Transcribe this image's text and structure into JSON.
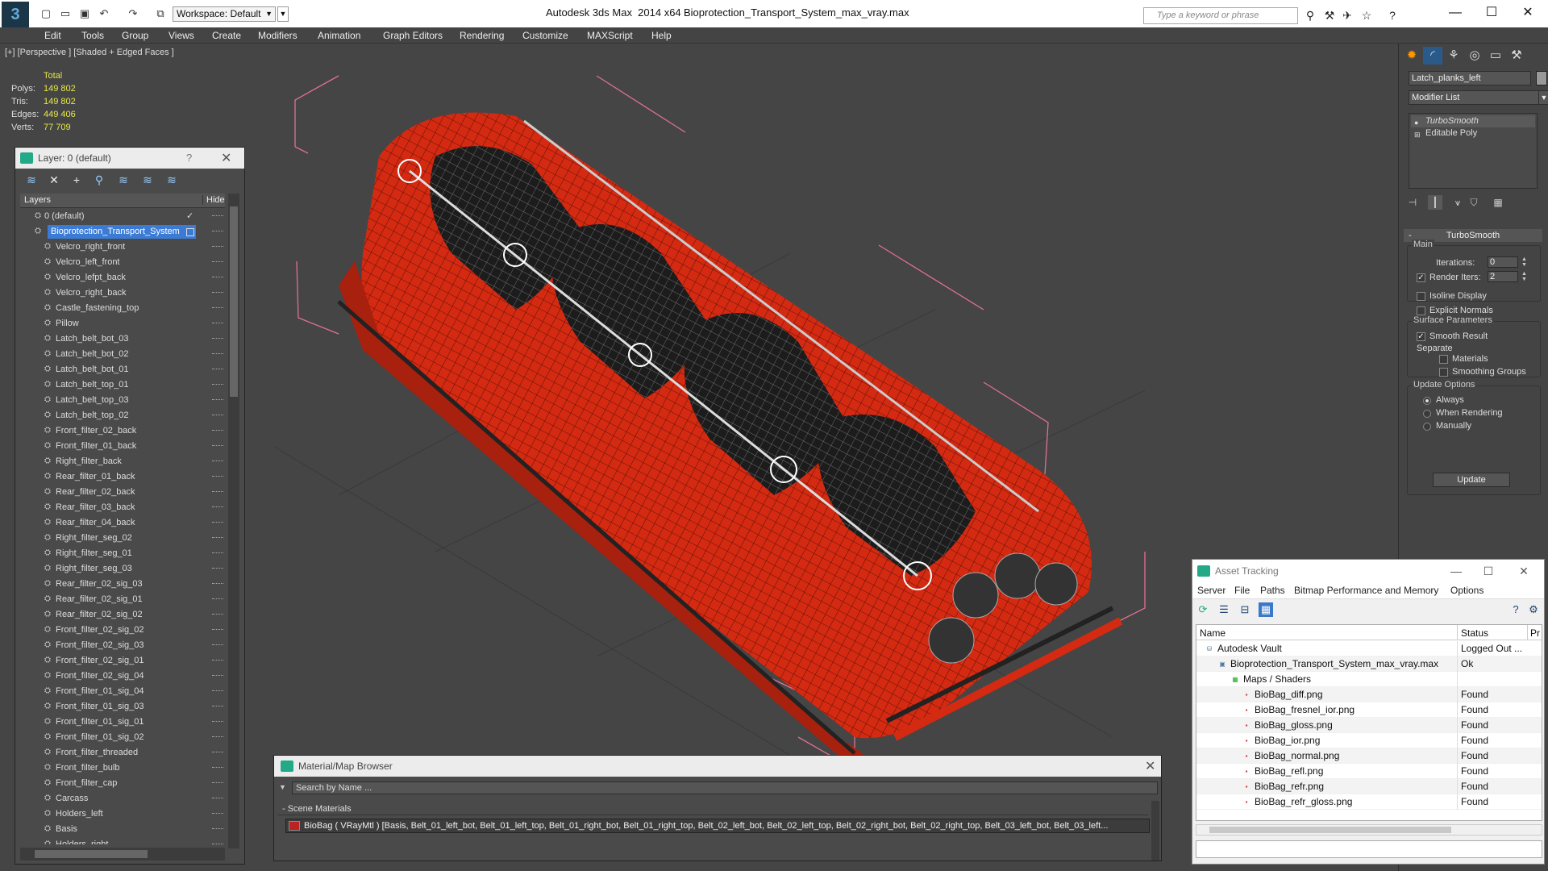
{
  "titlebar": {
    "workspace": "Workspace: Default",
    "app_title": "Autodesk 3ds Max  2014 x64",
    "document": "Bioprotection_Transport_System_max_vray.max",
    "search_placeholder": "Type a keyword or phrase"
  },
  "menu": [
    "Edit",
    "Tools",
    "Group",
    "Views",
    "Create",
    "Modifiers",
    "Animation",
    "Graph Editors",
    "Rendering",
    "Customize",
    "MAXScript",
    "Help"
  ],
  "viewport": {
    "label": "[+] [Perspective ] [Shaded + Edged Faces ]",
    "stats": {
      "header": "Total",
      "rows": [
        {
          "label": "Polys:",
          "value": "149 802"
        },
        {
          "label": "Tris:",
          "value": "149 802"
        },
        {
          "label": "Edges:",
          "value": "449 406"
        },
        {
          "label": "Verts:",
          "value": "77 709"
        }
      ]
    }
  },
  "layer_panel": {
    "title": "Layer: 0 (default)",
    "help": "?",
    "col_layers": "Layers",
    "col_hide": "Hide",
    "default_layer": "0 (default)",
    "selected_layer": "Bioprotection_Transport_System",
    "objects": [
      "Velcro_right_front",
      "Velcro_left_front",
      "Velcro_lefpt_back",
      "Velcro_right_back",
      "Castle_fastening_top",
      "Pillow",
      "Latch_belt_bot_03",
      "Latch_belt_bot_02",
      "Latch_belt_bot_01",
      "Latch_belt_top_01",
      "Latch_belt_top_03",
      "Latch_belt_top_02",
      "Front_filter_02_back",
      "Front_filter_01_back",
      "Right_filter_back",
      "Rear_filter_01_back",
      "Rear_filter_02_back",
      "Rear_filter_03_back",
      "Rear_filter_04_back",
      "Right_filter_seg_02",
      "Right_filter_seg_01",
      "Right_filter_seg_03",
      "Rear_filter_02_sig_03",
      "Rear_filter_02_sig_01",
      "Rear_filter_02_sig_02",
      "Front_filter_02_sig_02",
      "Front_filter_02_sig_03",
      "Front_filter_02_sig_01",
      "Front_filter_02_sig_04",
      "Front_filter_01_sig_04",
      "Front_filter_01_sig_03",
      "Front_filter_01_sig_01",
      "Front_filter_01_sig_02",
      "Front_filter_threaded",
      "Front_filter_bulb",
      "Front_filter_cap",
      "Carcass",
      "Holders_left",
      "Basis",
      "Holders_right"
    ]
  },
  "command_panel": {
    "object_name": "Latch_planks_left",
    "modifier_list": "Modifier List",
    "stack": [
      "TurboSmooth",
      "Editable Poly"
    ],
    "rollout": "TurboSmooth",
    "main_group": "Main",
    "iterations_label": "Iterations:",
    "iterations": "0",
    "render_iters_label": "Render Iters:",
    "render_iters": "2",
    "isoline": "Isoline Display",
    "explicit_normals": "Explicit Normals",
    "surface_group": "Surface Parameters",
    "smooth_result": "Smooth Result",
    "separate": "Separate",
    "materials": "Materials",
    "smoothing_groups": "Smoothing Groups",
    "update_group": "Update Options",
    "always": "Always",
    "when_rendering": "When Rendering",
    "manually": "Manually",
    "update_btn": "Update"
  },
  "material_browser": {
    "title": "Material/Map Browser",
    "search_placeholder": "Search by Name ...",
    "section": "- Scene Materials",
    "material": "BioBag ( VRayMtl ) [Basis, Belt_01_left_bot, Belt_01_left_top, Belt_01_right_bot, Belt_01_right_top, Belt_02_left_bot, Belt_02_left_top, Belt_02_right_bot, Belt_02_right_top, Belt_03_left_bot, Belt_03_left..."
  },
  "asset_tracking": {
    "title": "Asset Tracking",
    "menu": [
      "Server",
      "File",
      "Paths",
      "Bitmap Performance and Memory",
      "Options"
    ],
    "col_name": "Name",
    "col_status": "Status",
    "col_pr": "Pr",
    "rows": [
      {
        "name": "Autodesk Vault",
        "status": "Logged Out ..."
      },
      {
        "name": "Bioprotection_Transport_System_max_vray.max",
        "status": "Ok"
      },
      {
        "name": "Maps / Shaders",
        "status": ""
      },
      {
        "name": "BioBag_diff.png",
        "status": "Found"
      },
      {
        "name": "BioBag_fresnel_ior.png",
        "status": "Found"
      },
      {
        "name": "BioBag_gloss.png",
        "status": "Found"
      },
      {
        "name": "BioBag_ior.png",
        "status": "Found"
      },
      {
        "name": "BioBag_normal.png",
        "status": "Found"
      },
      {
        "name": "BioBag_refl.png",
        "status": "Found"
      },
      {
        "name": "BioBag_refr.png",
        "status": "Found"
      },
      {
        "name": "BioBag_refr_gloss.png",
        "status": "Found"
      }
    ]
  },
  "colors": {
    "model_red": "#d42a12",
    "selection_blue": "#3b7bd6",
    "stats_yellow": "#e8e84a"
  }
}
